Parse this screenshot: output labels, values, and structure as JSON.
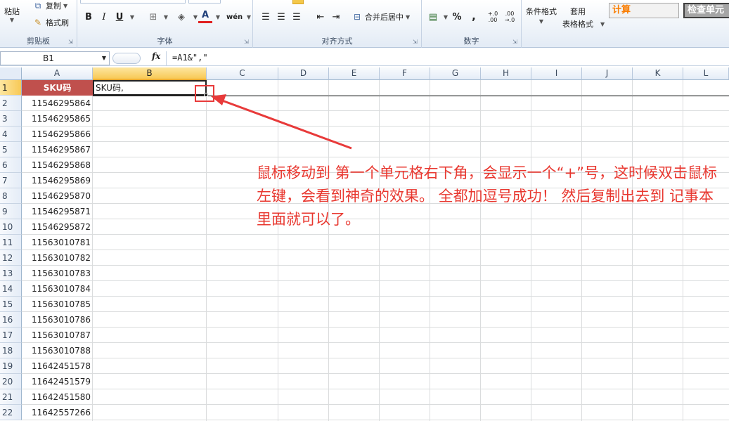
{
  "ribbon": {
    "clipboard": {
      "paste": "粘贴",
      "copy": "复制",
      "format_painter": "格式刷",
      "label": "剪贴板"
    },
    "font": {
      "bold": "B",
      "italic": "I",
      "underline": "U",
      "font_color": "A",
      "phonetic": "wén",
      "label": "字体"
    },
    "alignment": {
      "merge_center": "合并后居中",
      "label": "对齐方式"
    },
    "number": {
      "percent": "%",
      "comma": ",",
      "inc_decimal": "+.0 .00",
      "dec_decimal": ".00 →.0",
      "label": "数字"
    },
    "styles": {
      "conditional_format": "条件格式",
      "table_format_line1": "套用",
      "table_format_line2": "表格格式",
      "calc_style": "计算",
      "check_cell_style": "检查单元"
    }
  },
  "formula_bar": {
    "name_box": "B1",
    "fx": "fx",
    "formula": "=A1&\",\""
  },
  "columns": [
    "A",
    "B",
    "C",
    "D",
    "E",
    "F",
    "G",
    "H",
    "I",
    "J",
    "K",
    "L"
  ],
  "rows": [
    "1",
    "2",
    "3",
    "4",
    "5",
    "6",
    "7",
    "8",
    "9",
    "10",
    "11",
    "12",
    "13",
    "14",
    "15",
    "16",
    "17",
    "18",
    "19",
    "20",
    "21",
    "22"
  ],
  "cells": {
    "A1": "SKU码",
    "B1": "SKU码,",
    "A_values": [
      "11546295864",
      "11546295865",
      "11546295866",
      "11546295867",
      "11546295868",
      "11546295869",
      "11546295870",
      "11546295871",
      "11546295872",
      "11563010781",
      "11563010782",
      "11563010783",
      "11563010784",
      "11563010785",
      "11563010786",
      "11563010787",
      "11563010788",
      "11642451578",
      "11642451579",
      "11642451580",
      "11642557266"
    ]
  },
  "annotation": {
    "text": "鼠标移动到 第一个单元格右下角，会显示一个“+”号，这时候双击鼠标左键，会看到神奇的效果。 全都加逗号成功！ 然后复制出去到 记事本里面就可以了。"
  },
  "colors": {
    "header_cell_bg": "#c0504d",
    "annotation_red": "#e8372f",
    "active_header": "#f8c956",
    "calc_text": "#fa7d00"
  }
}
